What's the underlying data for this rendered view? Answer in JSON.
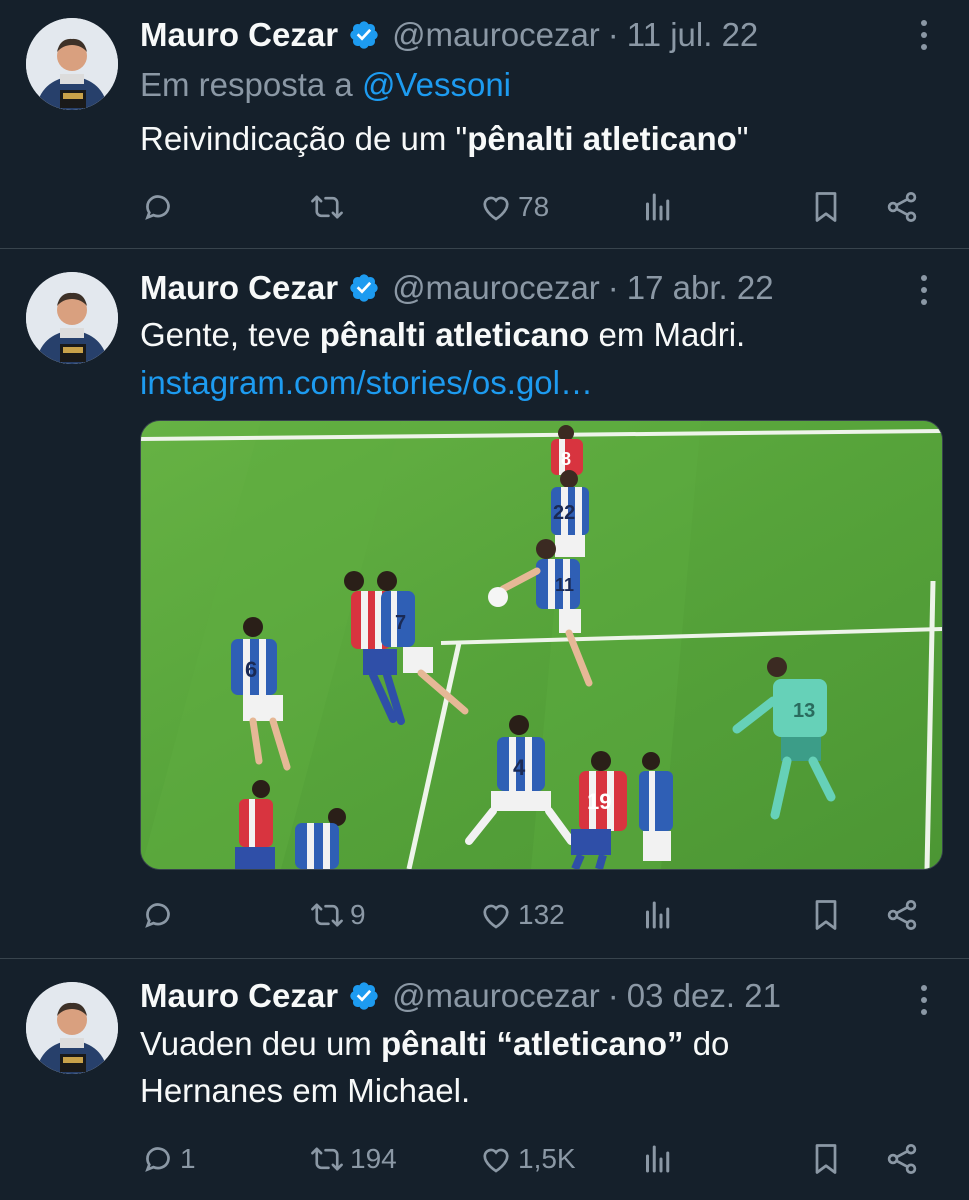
{
  "tweets": [
    {
      "name": "Mauro Cezar",
      "handle": "@maurocezar",
      "separator": "·",
      "date": "11 jul. 22",
      "reply_prefix": "Em resposta a",
      "reply_to": "@Vessoni",
      "text_parts": [
        "Reivindicação de um \"",
        "pênalti atleticano",
        "\""
      ],
      "stats": {
        "replies": "",
        "retweets": "",
        "likes": "78"
      }
    },
    {
      "name": "Mauro Cezar",
      "handle": "@maurocezar",
      "separator": "·",
      "date": "17 abr. 22",
      "text_parts": [
        "Gente, teve ",
        "pênalti atleticano",
        " em Madri."
      ],
      "link": "instagram.com/stories/os.gol…",
      "stats": {
        "replies": "",
        "retweets": "9",
        "likes": "132"
      },
      "media": {
        "kind": "football-match-photo",
        "colors": {
          "pitch": "#5aa63a",
          "red_team": "#d8343f",
          "blue_team": "#2f5fb5",
          "keeper": "#66d1b8"
        },
        "jersey_numbers": [
          "8",
          "22",
          "11",
          "6",
          "7",
          "4",
          "19",
          "13"
        ]
      }
    },
    {
      "name": "Mauro Cezar",
      "handle": "@maurocezar",
      "separator": "·",
      "date": "03 dez. 21",
      "text_parts": [
        "Vuaden deu um ",
        "pênalti “atleticano”",
        " do"
      ],
      "text_line2": "Hernanes em Michael.",
      "stats": {
        "replies": "1",
        "retweets": "194",
        "likes": "1,5K"
      }
    }
  ],
  "icons": {
    "reply": "reply-icon",
    "retweet": "retweet-icon",
    "like": "heart-icon",
    "views": "views-icon",
    "bookmark": "bookmark-icon",
    "share": "share-icon",
    "more": "more-dots-icon",
    "verified": "verified-badge-icon"
  },
  "theme": {
    "background": "#15202b",
    "text": "#f7f9f9",
    "muted": "#8b98a5",
    "accent": "#1d9bf0",
    "divider": "#38444d"
  }
}
